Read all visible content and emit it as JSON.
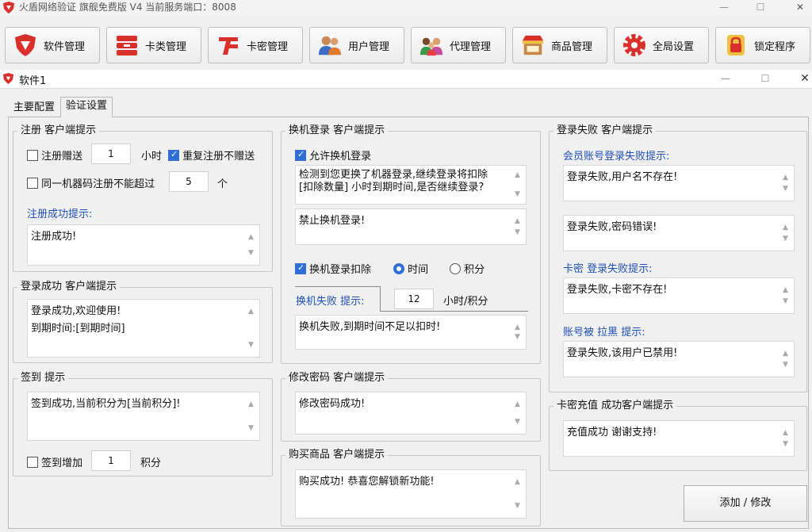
{
  "window": {
    "title": "火盾网络验证 旗舰免费版 V4    当前服务端口：8008",
    "min": "—",
    "max": "☐",
    "close": "✕"
  },
  "toolbar": {
    "buttons": [
      {
        "label": "软件管理",
        "icon": "shield-icon"
      },
      {
        "label": "卡类管理",
        "icon": "card-stack-icon"
      },
      {
        "label": "卡密管理",
        "icon": "card-key-icon"
      },
      {
        "label": "用户管理",
        "icon": "users-icon"
      },
      {
        "label": "代理管理",
        "icon": "agents-icon"
      },
      {
        "label": "商品管理",
        "icon": "shop-icon"
      },
      {
        "label": "全局设置",
        "icon": "gear-icon"
      },
      {
        "label": "锁定程序",
        "icon": "lock-icon"
      }
    ],
    "colors": {
      "red": "#d9302c",
      "orange": "#e8a020"
    }
  },
  "child": {
    "title": "软件1",
    "min": "—",
    "max": "☐",
    "close": "✕"
  },
  "tabs": {
    "main": "主要配置",
    "verify": "验证设置"
  },
  "register": {
    "group_title": "注册 客户端提示",
    "gift_label": "注册赠送",
    "gift_value": "1",
    "gift_unit": "小时",
    "repeat_label": "重复注册不赠送",
    "machine_label": "同一机器码注册不能超过",
    "machine_value": "5",
    "machine_unit": "个",
    "success_label": "注册成功提示:",
    "success_text": "注册成功!"
  },
  "login": {
    "group_title": "登录成功 客户端提示",
    "line1": "登录成功,欢迎使用!",
    "line2": "到期时间:[到期时间]"
  },
  "signin": {
    "group_title": "签到 提示",
    "text": "签到成功,当前积分为[当前积分]!",
    "add_label": "签到增加",
    "add_value": "1",
    "add_unit": "积分"
  },
  "switch": {
    "group_title": "换机登录 客户端提示",
    "allow_label": "允许换机登录",
    "deduct_text": "检测到您更换了机器登录,继续登录将扣除 [扣除数量] 小时到期时间,是否继续登录?",
    "forbid_text": "禁止换机登录!",
    "deduct_label": "换机登录扣除",
    "opt_time": "时间",
    "opt_points": "积分",
    "fail_label": "换机失败 提示:",
    "fail_value": "12",
    "fail_unit": "小时/积分",
    "fail_text": "换机失败,到期时间不足以扣时!"
  },
  "password": {
    "group_title": "修改密码 客户端提示",
    "text": "修改密码成功!"
  },
  "purchase": {
    "group_title": "购买商品 客户端提示",
    "text": "购买成功! 恭喜您解锁新功能!"
  },
  "loginfail": {
    "group_title": "登录失败 客户端提示",
    "member_label": "会员账号登录失败提示:",
    "user_missing": "登录失败,用户名不存在!",
    "pwd_wrong": "登录失败,密码错误!",
    "card_label": "卡密 登录失败提示:",
    "card_missing": "登录失败,卡密不存在!",
    "ban_label": "账号被 拉黑 提示:",
    "banned": "登录失败,该用户已禁用!"
  },
  "recharge": {
    "group_title": "卡密充值 成功客户端提示",
    "text": "充值成功 谢谢支持!"
  },
  "actions": {
    "save": "添加 / 修改"
  }
}
